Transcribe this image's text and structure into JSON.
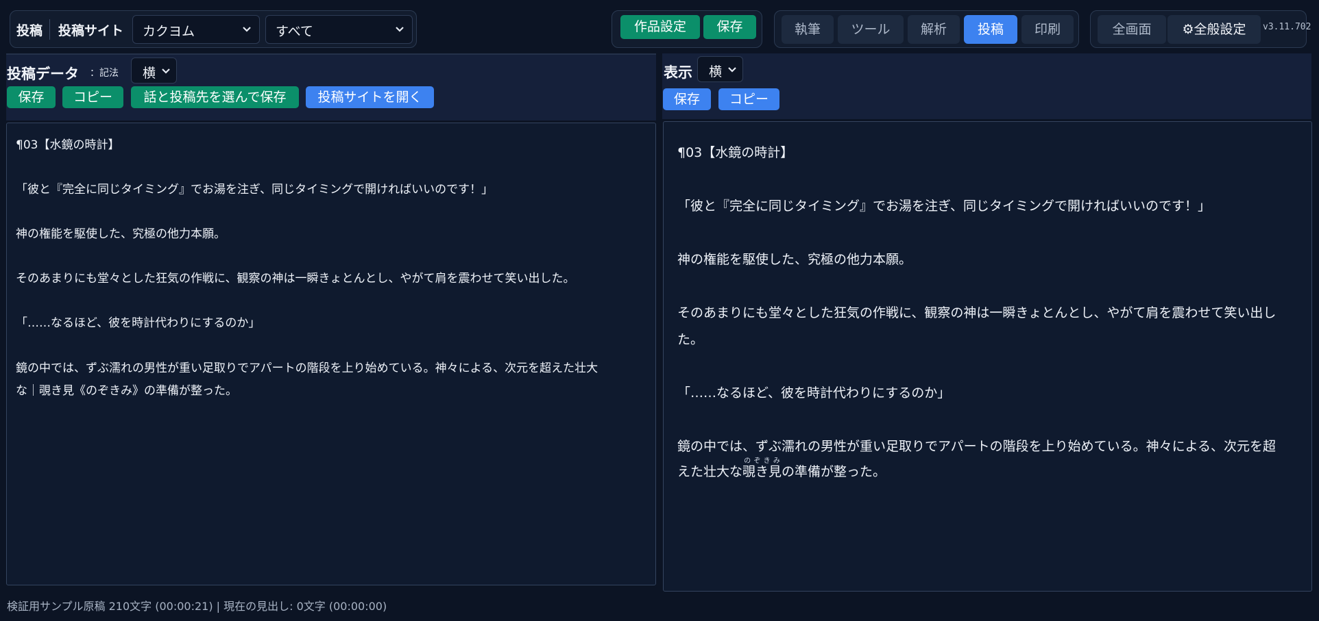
{
  "top": {
    "mode_label": "投稿",
    "site_label": "投稿サイト",
    "site_select": "カクヨム",
    "scope_select": "すべて",
    "work_settings": "作品設定",
    "save": "保存",
    "tabs": [
      "執筆",
      "ツール",
      "解析",
      "投稿",
      "印刷"
    ],
    "active_tab": "投稿",
    "fullscreen": "全画面",
    "global_settings": "⚙全般設定",
    "version": "v3.11.702"
  },
  "left": {
    "title": "投稿データ",
    "notation_label": "：記法",
    "notation_select": "横",
    "buttons": {
      "save": "保存",
      "copy": "コピー",
      "save_choose": "話と投稿先を選んで保存",
      "open_site": "投稿サイトを開く"
    },
    "lines": [
      "¶03【水鏡の時計】",
      "「彼と『完全に同じタイミング』でお湯を注ぎ、同じタイミングで開ければいいのです！」",
      "神の権能を駆使した、究極の他力本願。",
      "そのあまりにも堂々とした狂気の作戦に、観察の神は一瞬きょとんとし、やがて肩を震わせて笑い出した。",
      "「……なるほど、彼を時計代わりにするのか」",
      "鏡の中では、ずぶ濡れの男性が重い足取りでアパートの階段を上り始めている。神々による、次元を超えた壮大",
      "な｜覗き見《のぞきみ》の準備が整った。"
    ]
  },
  "right": {
    "title": "表示",
    "view_select": "横",
    "buttons": {
      "save": "保存",
      "copy": "コピー"
    },
    "lines": [
      "¶03【水鏡の時計】",
      "「彼と『完全に同じタイミング』でお湯を注ぎ、同じタイミングで開ければいいのです！」",
      "神の権能を駆使した、究極の他力本願。",
      "そのあまりにも堂々とした狂気の作戦に、観察の神は一瞬きょとんとし、やがて肩を震わせて笑い出し",
      "た。",
      "「……なるほど、彼を時計代わりにするのか」",
      "鏡の中では、ずぶ濡れの男性が重い足取りでアパートの階段を上り始めている。神々による、次元を超"
    ],
    "last_line_prefix": "えた壮大な",
    "ruby_base": "覗き見",
    "ruby_text": "のぞきみ",
    "last_line_suffix": "の準備が整った。"
  },
  "status": "検証用サンプル原稿 210文字 (00:00:21) | 現在の見出し: 0文字 (00:00:00)"
}
